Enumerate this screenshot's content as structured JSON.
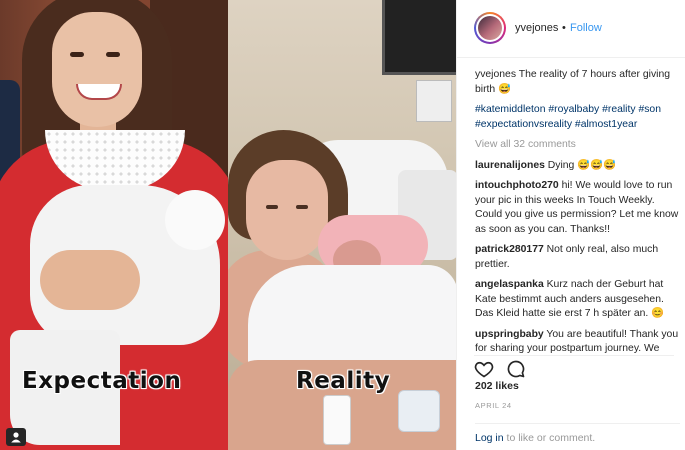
{
  "images": {
    "left_caption": "Expectation",
    "right_caption": "Reality"
  },
  "post": {
    "username": "yvejones",
    "separator": "•",
    "follow_label": "Follow",
    "caption_username": "yvejones",
    "caption_text": "The reality of 7 hours after giving birth 😅",
    "hashtags": "#katemiddleton #royalbaby #reality #son #expectationvsreality #almost1year",
    "view_all_comments": "View all 32 comments",
    "comments": [
      {
        "user": "laurenalijones",
        "text": "Dying 😅😅😅"
      },
      {
        "user": "intouchphoto270",
        "text": "hi! We would love to run your pic in this weeks In Touch Weekly. Could you give us permission? Let me know as soon as you can. Thanks!!"
      },
      {
        "user": "patrick280177",
        "text": "Not only real, also much prettier."
      },
      {
        "user": "angelaspanka",
        "text": "Kurz nach der Geburt hat Kate bestimmt auch anders ausgesehen. Das Kleid hatte sie erst 7 h später an. 😊"
      },
      {
        "user": "upspringbaby",
        "text": "You are beautiful! Thank you for sharing your postpartum journey. We"
      }
    ],
    "likes": "202 likes",
    "date": "APRIL 24",
    "login_link": "Log in",
    "login_rest": " to like or comment."
  },
  "icons": {
    "like": "heart-icon",
    "comment": "comment-bubble-icon",
    "tagged": "user-tag-icon"
  },
  "colors": {
    "link_blue": "#3897f0",
    "hashtag_blue": "#003569",
    "muted_gray": "#999999",
    "text": "#262626"
  }
}
